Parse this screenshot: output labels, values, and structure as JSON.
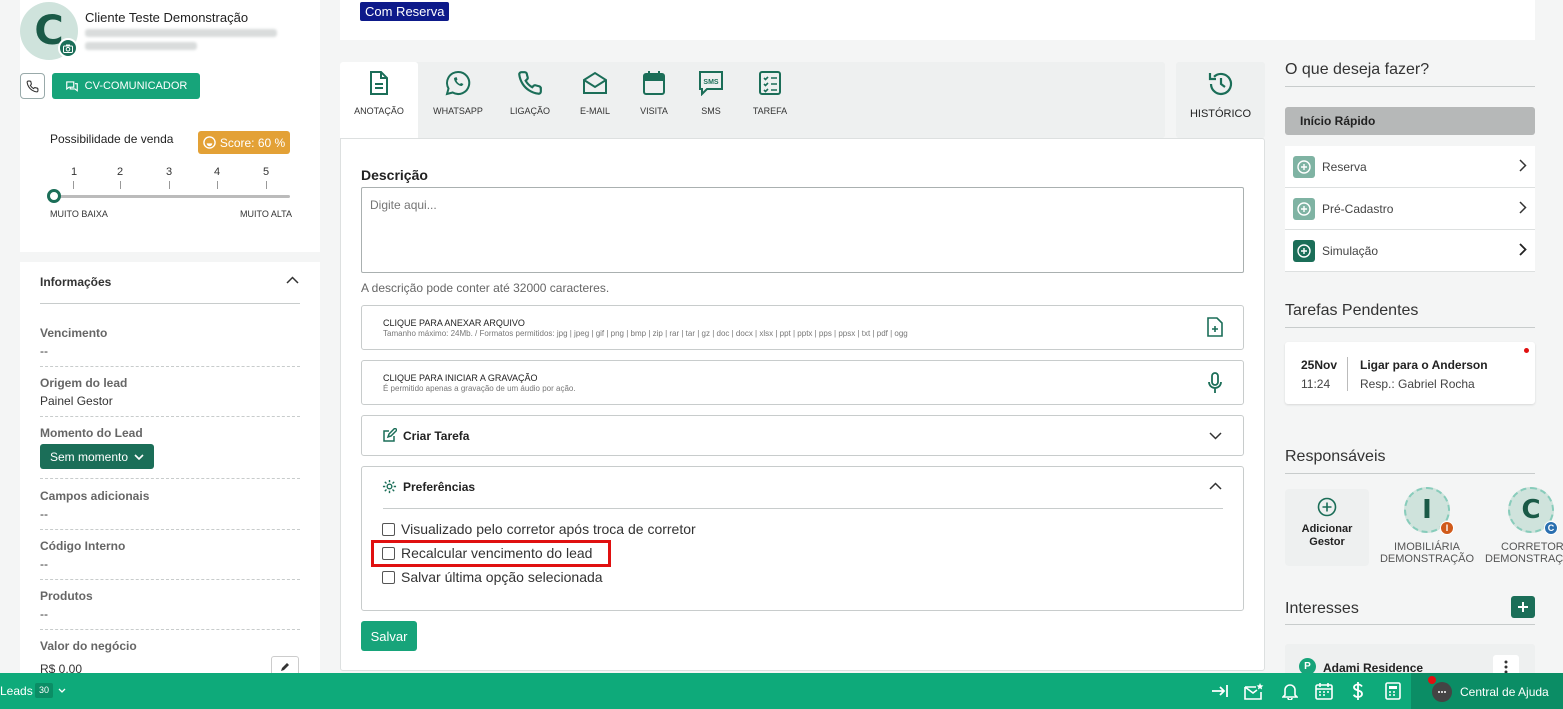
{
  "client": {
    "initial": "C",
    "name": "Cliente Teste Demonstração"
  },
  "buttons": {
    "cv_comunicador": "CV-COMUNICADOR"
  },
  "possibility": {
    "title": "Possibilidade de venda",
    "score": "Score: 60 %",
    "scale": [
      "1",
      "2",
      "3",
      "4",
      "5"
    ],
    "low_label": "MUITO BAIXA",
    "high_label": "MUITO ALTA",
    "selected": "1"
  },
  "info": {
    "title": "Informações",
    "fields": [
      {
        "label": "Vencimento",
        "value": "--"
      },
      {
        "label": "Origem do lead",
        "value": "Painel Gestor"
      },
      {
        "label": "Momento do Lead",
        "value": "Sem momento"
      },
      {
        "label": "Campos adicionais",
        "value": "--"
      },
      {
        "label": "Código Interno",
        "value": "--"
      },
      {
        "label": "Produtos",
        "value": "--"
      },
      {
        "label": "Valor do negócio",
        "value": "R$ 0,00"
      }
    ]
  },
  "status_badge": "Com Reserva",
  "tabs": [
    {
      "label": "ANOTAÇÃO",
      "icon": "document-icon",
      "active": true
    },
    {
      "label": "WHATSAPP",
      "icon": "whatsapp-icon"
    },
    {
      "label": "LIGAÇÃO",
      "icon": "phone-icon"
    },
    {
      "label": "E-MAIL",
      "icon": "email-icon"
    },
    {
      "label": "VISITA",
      "icon": "calendar-icon"
    },
    {
      "label": "SMS",
      "icon": "sms-icon"
    },
    {
      "label": "TAREFA",
      "icon": "checklist-icon"
    }
  ],
  "historico": "HISTÓRICO",
  "form": {
    "description_title": "Descrição",
    "description_placeholder": "Digite aqui...",
    "description_hint": "A descrição pode conter até 32000 caracteres.",
    "attach_title": "CLIQUE PARA ANEXAR ARQUIVO",
    "attach_sub": "Tamanho máximo: 24Mb. / Formatos permitidos: jpg | jpeg | gif | png | bmp | zip | rar | tar | gz | doc | docx | xlsx | ppt | pptx | pps | ppsx | txt | pdf | ogg",
    "record_title": "CLIQUE PARA INICIAR A GRAVAÇÃO",
    "record_sub": "É permitido apenas a gravação de um áudio por ação.",
    "create_task": "Criar Tarefa",
    "preferences": "Preferências",
    "options": [
      "Visualizado pelo corretor após troca de corretor",
      "Recalcular vencimento do lead",
      "Salvar última opção selecionada"
    ],
    "save": "Salvar"
  },
  "right": {
    "what_to_do": "O que deseja fazer?",
    "quick_start": "Início Rápido",
    "quick_items": [
      "Reserva",
      "Pré-Cadastro",
      "Simulação"
    ],
    "pending_title": "Tarefas Pendentes",
    "task": {
      "date": "25Nov",
      "time": "11:24",
      "title": "Ligar para o Anderson",
      "resp": "Resp.: Gabriel Rocha"
    },
    "responsaveis_title": "Responsáveis",
    "add_gestor": "Adicionar Gestor",
    "responsaveis": [
      {
        "initial": "I",
        "badge": "I",
        "line1": "IMOBILIÁRIA",
        "line2": "DEMONSTRAÇÃO",
        "badge_color": "#d05a1a"
      },
      {
        "initial": "C",
        "badge": "C",
        "line1": "CORRETOR",
        "line2": "DEMONSTRAÇ",
        "badge_color": "#2a6fb0"
      }
    ],
    "interesses_title": "Interesses",
    "interesse": {
      "initial": "P",
      "name": "Adami Residence"
    }
  },
  "bottom": {
    "leads_label": "Leads",
    "leads_count": "30",
    "help": "Central de Ajuda"
  },
  "colors": {
    "primary": "#17a47a",
    "dark": "#1b6e58",
    "bar": "#0eaa7a",
    "badge": "#0d1a8a",
    "highlight": "#e01010"
  }
}
